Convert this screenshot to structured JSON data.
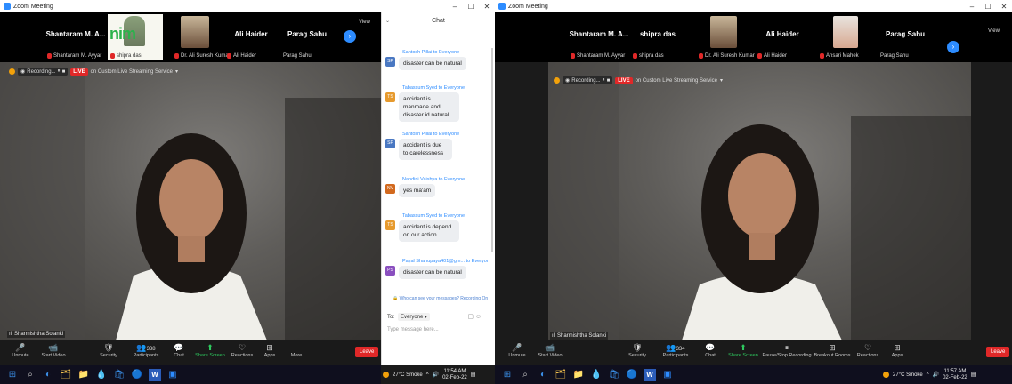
{
  "windows": [
    {
      "title": "Zoom Meeting",
      "controls": [
        "–",
        "☐",
        "✕"
      ],
      "strip": [
        {
          "name": "Shantaram M. A...",
          "label": "Shantaram M. Ayyar"
        },
        {
          "name": "",
          "label": "shipra das",
          "thumb": true,
          "logo": "nim"
        },
        {
          "name": "",
          "label": "Dr. Ali Suresh Kumar",
          "thumb": true
        },
        {
          "name": "Ali Haider",
          "label": "Ali Haider"
        },
        {
          "name": "Parag Sahu",
          "label": "Parag Sahu"
        }
      ],
      "view_label": "View",
      "recording": {
        "label": "Recording...",
        "live": "LIVE",
        "service": "on Custom Live Streaming Service"
      },
      "speaker": "Sharmishtha Solanki",
      "toolbar": [
        {
          "icon": "🎤",
          "label": "Unmute",
          "name": "unmute-button"
        },
        {
          "icon": "📹",
          "label": "Start Video",
          "name": "start-video-button"
        },
        {
          "icon": "🛡",
          "label": "Security",
          "name": "security-button"
        },
        {
          "icon": "👥",
          "label": "Participants",
          "count": "338",
          "name": "participants-button"
        },
        {
          "icon": "💬",
          "label": "Chat",
          "name": "chat-button"
        },
        {
          "icon": "⬆",
          "label": "Share Screen",
          "name": "share-screen-button",
          "green": true
        },
        {
          "icon": "♡",
          "label": "Reactions",
          "name": "reactions-button"
        },
        {
          "icon": "⊞",
          "label": "Apps",
          "name": "apps-button"
        },
        {
          "icon": "···",
          "label": "More",
          "name": "more-button"
        }
      ],
      "leave": "Leave",
      "chat": {
        "title": "Chat",
        "messages": [
          {
            "from": "Santosh Pillai to Everyone",
            "initials": "SP",
            "color": "#4a78c2",
            "text": "disaster can be natural"
          },
          {
            "from": "Tabassum Syed to Everyone",
            "initials": "TS",
            "color": "#e69a2e",
            "text": "accident is manmade and disaster id natural"
          },
          {
            "from": "Santosh Pillai to Everyone",
            "initials": "SP",
            "color": "#4a78c2",
            "text": "accident is due to carelessness"
          },
          {
            "from": "Nandini Vaishya to Everyone",
            "initials": "NV",
            "color": "#d2691e",
            "text": "yes ma'am"
          },
          {
            "from": "Tabassum Syed to Everyone",
            "initials": "TS",
            "color": "#e69a2e",
            "text": "accident is depend on our action"
          },
          {
            "from": "Payal Shahupaya401@gm... to Everyone",
            "initials": "PS",
            "color": "#8a4fbf",
            "text": "disaster can be natural"
          }
        ],
        "note": "Who can see your messages? Recording On",
        "to_label": "To:",
        "to_value": "Everyone ▾",
        "placeholder": "Type message here..."
      },
      "tray": {
        "weather": "27°C  Smoke",
        "time": "11:54 AM",
        "date": "02-Feb-22"
      }
    },
    {
      "title": "Zoom Meeting",
      "controls": [
        "–",
        "☐",
        "✕"
      ],
      "strip": [
        {
          "name": "Shantaram M. A...",
          "label": "Shantaram M. Ayyar"
        },
        {
          "name": "shipra das",
          "label": "shipra das"
        },
        {
          "name": "",
          "label": "Dr. Ali Suresh Kumar",
          "thumb": true
        },
        {
          "name": "Ali Haider",
          "label": "Ali Haider"
        },
        {
          "name": "",
          "label": "Ansari Mahek",
          "thumb": true
        },
        {
          "name": "Parag Sahu",
          "label": "Parag Sahu"
        }
      ],
      "view_label": "View",
      "recording": {
        "label": "Recording...",
        "live": "LIVE",
        "service": "on Custom Live Streaming Service"
      },
      "speaker": "Sharmishtha Solanki",
      "toolbar": [
        {
          "icon": "🎤",
          "label": "Unmute",
          "name": "unmute-button"
        },
        {
          "icon": "📹",
          "label": "Start Video",
          "name": "start-video-button"
        },
        {
          "icon": "🛡",
          "label": "Security",
          "name": "security-button"
        },
        {
          "icon": "👥",
          "label": "Participants",
          "count": "334",
          "name": "participants-button"
        },
        {
          "icon": "💬",
          "label": "Chat",
          "name": "chat-button"
        },
        {
          "icon": "⬆",
          "label": "Share Screen",
          "name": "share-screen-button",
          "green": true
        },
        {
          "icon": "⏸",
          "label": "Pause/Stop Recording",
          "name": "pause-recording-button"
        },
        {
          "icon": "⊞",
          "label": "Breakout Rooms",
          "name": "breakout-rooms-button"
        },
        {
          "icon": "♡",
          "label": "Reactions",
          "name": "reactions-button"
        },
        {
          "icon": "⊞",
          "label": "Apps",
          "name": "apps-button"
        }
      ],
      "leave": "Leave",
      "tray": {
        "weather": "27°C  Smoke",
        "time": "11:57 AM",
        "date": "02-Feb-22"
      }
    }
  ],
  "taskbar_icons": [
    "⊞",
    "⌕",
    "◐",
    "🗂",
    "📁",
    "💧",
    "🛍",
    "🔵",
    "W",
    "▣"
  ]
}
